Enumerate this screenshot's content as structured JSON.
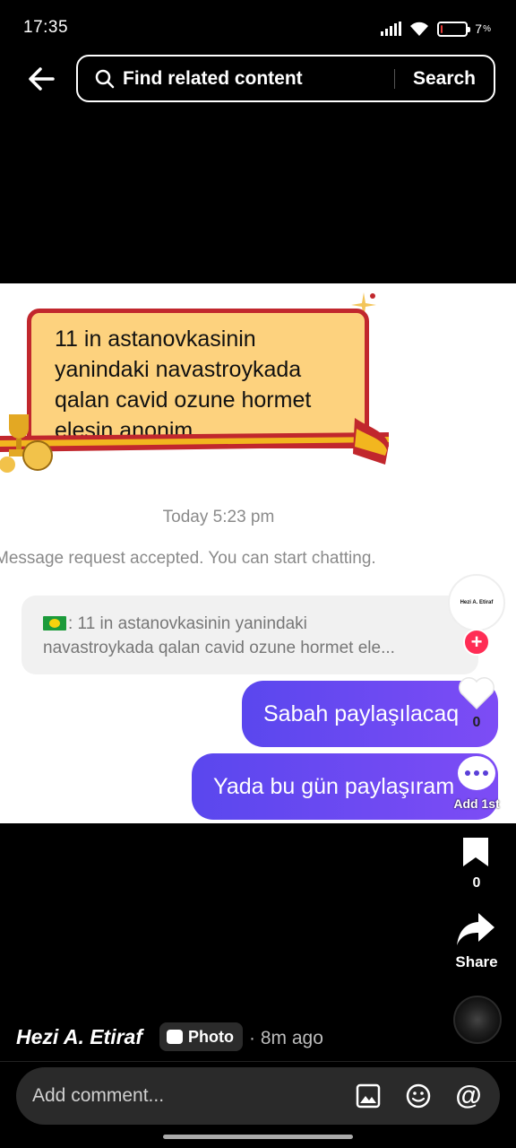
{
  "status_bar": {
    "time": "17:35",
    "battery_percent_label": "7",
    "battery_level": 0.07,
    "battery_color": "#e53935",
    "icons": [
      "signal-icon",
      "wifi-icon",
      "battery-icon"
    ]
  },
  "top_bar": {
    "back_icon": "back-arrow-icon",
    "search_placeholder": "Find related content",
    "search_button": "Search"
  },
  "photo": {
    "banner_text": "11 in astanovkasinin yanindaki navastroykada qalan cavid ozune hormet elesin anonim",
    "chat_timestamp": "Today 5:23 pm",
    "chat_note": "Message request accepted. You can start chatting.",
    "quote_line_1": ": 11 in astanovkasinin yanindaki",
    "quote_line_2": "navastroykada qalan cavid ozune hormet ele...",
    "bubble_1": "Sabah paylaşılacaq",
    "bubble_2": "Yada bu gün paylaşıram",
    "accent_color": "#6a48f2"
  },
  "right_rail": {
    "avatar_label": "Hezi A. Etiraf",
    "like_count": "0",
    "comment_label": "Add 1st",
    "bookmark_count": "0",
    "share_label": "Share"
  },
  "post_info": {
    "author": "Hezi A. Etiraf",
    "type_badge": "Photo",
    "time_ago": "· 8m ago"
  },
  "comment_bar": {
    "placeholder": "Add comment...",
    "icons": [
      "image-icon",
      "emoji-icon",
      "mention-icon"
    ],
    "mention_symbol": "@"
  }
}
